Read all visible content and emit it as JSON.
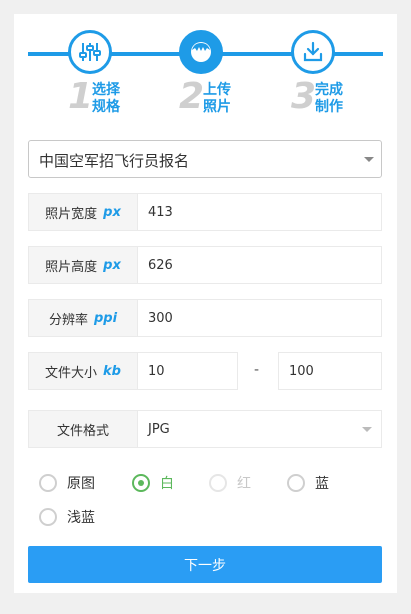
{
  "steps": [
    {
      "num": "1",
      "line1": "选择",
      "line2": "规格",
      "icon": "sliders-icon"
    },
    {
      "num": "2",
      "line1": "上传",
      "line2": "照片",
      "icon": "portrait-icon"
    },
    {
      "num": "3",
      "line1": "完成",
      "line2": "制作",
      "icon": "download-icon"
    }
  ],
  "spec_select": {
    "value": "中国空军招飞行员报名"
  },
  "fields": {
    "width": {
      "label": "照片宽度",
      "unit": "px",
      "value": "413"
    },
    "height": {
      "label": "照片高度",
      "unit": "px",
      "value": "626"
    },
    "resolution": {
      "label": "分辨率",
      "unit": "ppi",
      "value": "300"
    },
    "filesize": {
      "label": "文件大小",
      "unit": "kb",
      "min": "10",
      "sep": "-",
      "max": "100"
    },
    "format": {
      "label": "文件格式",
      "value": "JPG"
    }
  },
  "backgrounds": [
    {
      "label": "原图",
      "state": "unselected"
    },
    {
      "label": "白",
      "state": "selected"
    },
    {
      "label": "红",
      "state": "disabled"
    },
    {
      "label": "蓝",
      "state": "unselected"
    },
    {
      "label": "浅蓝",
      "state": "unselected"
    }
  ],
  "next_button": {
    "label": "下一步"
  },
  "colors": {
    "accent": "#1e9be7",
    "button": "#2a9df4",
    "selected_radio": "#5cb85c"
  }
}
